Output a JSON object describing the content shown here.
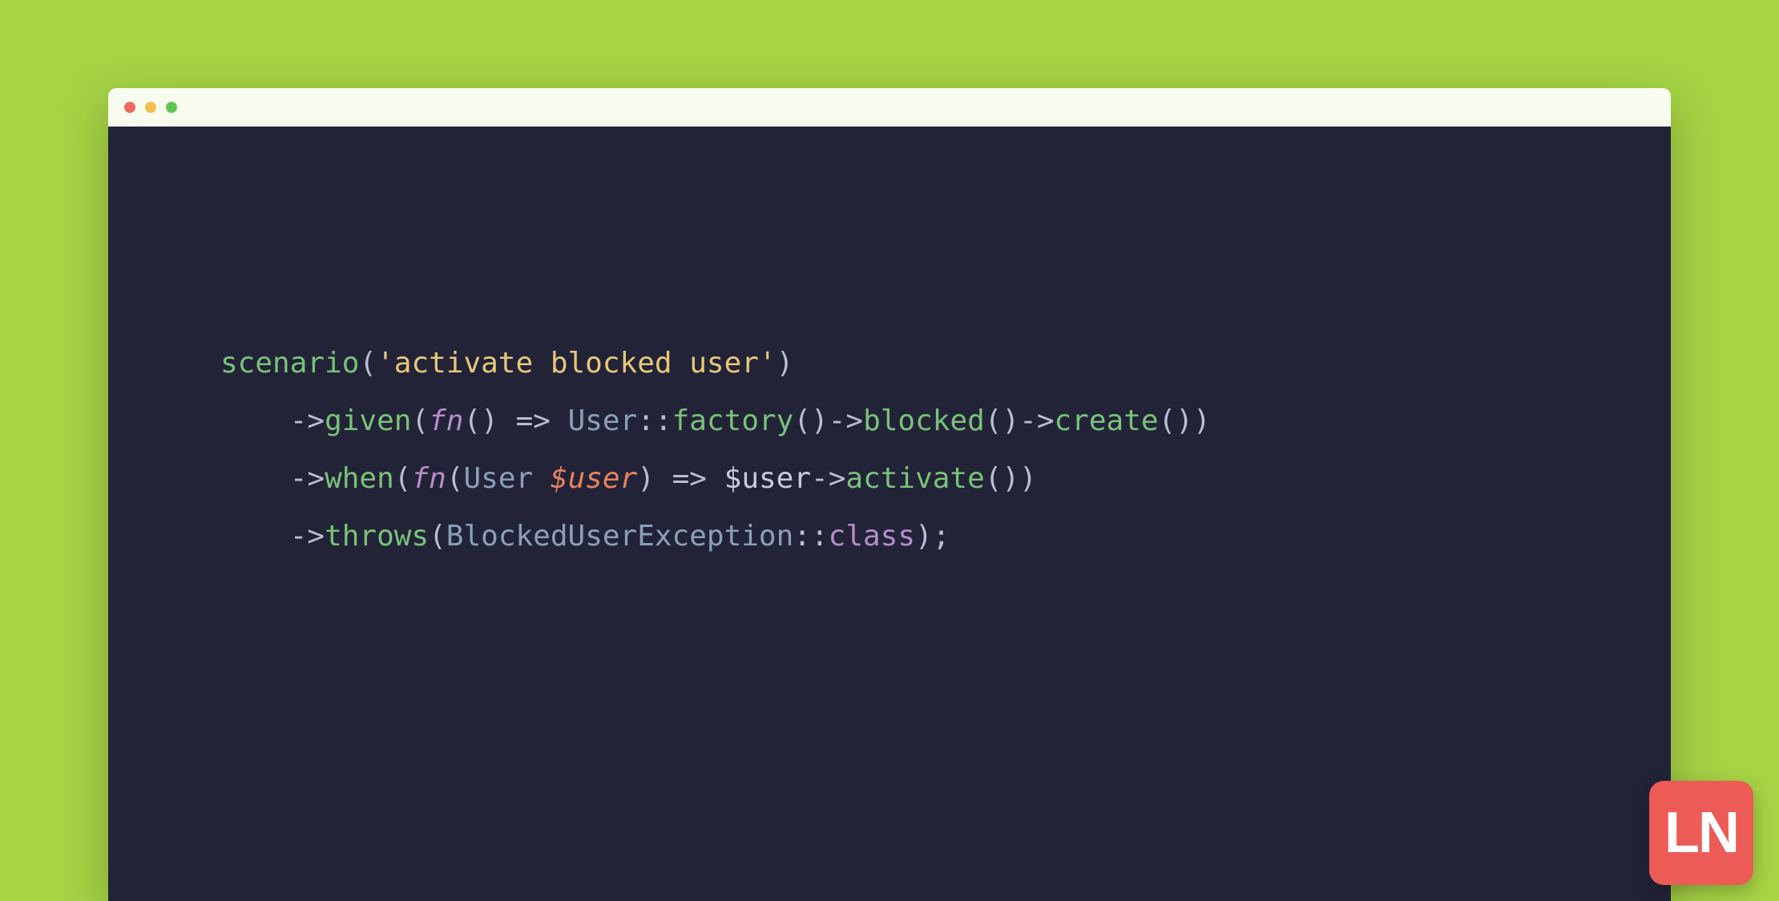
{
  "colors": {
    "page_bg": "#a6d445",
    "titlebar_bg": "#f7fcef",
    "editor_bg": "#232338",
    "badge_bg": "#ec5b56",
    "badge_fg": "#ffffff",
    "syntax": {
      "function": "#79c27a",
      "string": "#e7c77a",
      "punctuation": "#b9bed4",
      "keyword": "#b58ec9",
      "class": "#8aa0b8",
      "variable": "#e8835e",
      "text": "#c7cbe0"
    }
  },
  "traffic_lights": [
    "red",
    "yellow",
    "green"
  ],
  "code": {
    "indent": "    ",
    "line1": {
      "fn": "scenario",
      "open": "(",
      "quote1": "'",
      "str": "activate blocked user",
      "quote2": "'",
      "close": ")"
    },
    "line2": {
      "arrow": "->",
      "fn": "given",
      "open": "(",
      "kw": "fn",
      "args_open": "(",
      "args_close": ")",
      "op": " => ",
      "cls1": "User",
      "sep": "::",
      "m1": "factory",
      "p1o": "(",
      "p1c": ")",
      "arrow2": "->",
      "m2": "blocked",
      "p2o": "(",
      "p2c": ")",
      "arrow3": "->",
      "m3": "create",
      "p3o": "(",
      "p3c": ")",
      "close": ")"
    },
    "line3": {
      "arrow": "->",
      "fn": "when",
      "open": "(",
      "kw": "fn",
      "args_open": "(",
      "param_type": "User",
      "space": " ",
      "param_var": "$user",
      "args_close": ")",
      "op": " => ",
      "var": "$user",
      "arrow2": "->",
      "m1": "activate",
      "p1o": "(",
      "p1c": ")",
      "close": ")"
    },
    "line4": {
      "arrow": "->",
      "fn": "throws",
      "open": "(",
      "cls": "BlockedUserException",
      "sep": "::",
      "const": "class",
      "close": ")",
      "semi": ";"
    }
  },
  "badge": {
    "text": "LN"
  }
}
